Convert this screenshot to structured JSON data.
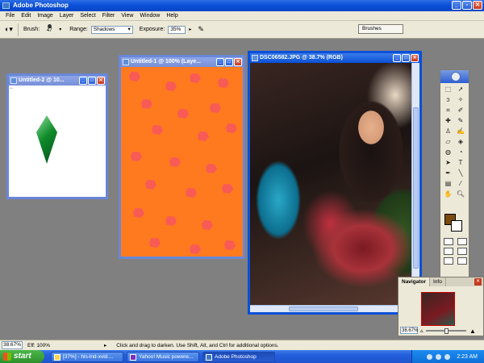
{
  "app": {
    "title": "Adobe Photoshop"
  },
  "menu": [
    "File",
    "Edit",
    "Image",
    "Layer",
    "Select",
    "Filter",
    "View",
    "Window",
    "Help"
  ],
  "options": {
    "brush_label": "Brush:",
    "brush_size": "47",
    "range_label": "Range:",
    "range_value": "Shadows",
    "exposure_label": "Exposure:",
    "exposure_value": "35%",
    "brushes_tab": "Brushes"
  },
  "windows": {
    "doc2_title": "Untitled-2 @ 10...",
    "doc1_title": "Untitled-1 @ 100% (Laye...",
    "photo_title": "DSC06582.JPG @ 38.7% (RGB)"
  },
  "navigator": {
    "tab_navigator": "Navigator",
    "tab_info": "Info",
    "zoom": "38.67%"
  },
  "status": {
    "zoom": "38.67%",
    "efficiency": "Eff: 100%",
    "tip": "Click and drag to darken.  Use Shift, Alt, and Ctrl for additional options."
  },
  "taskbar": {
    "start": "start",
    "tasks": [
      "[37%] - hls-lnd-xvid....",
      "Yahoo! Music powere...",
      "Adobe Photoshop"
    ],
    "clock": "2:23 AM"
  },
  "colors": {
    "foreground": "#7a4a0e",
    "background": "#ffffff",
    "canvas_orange": "#ff7a1f"
  }
}
